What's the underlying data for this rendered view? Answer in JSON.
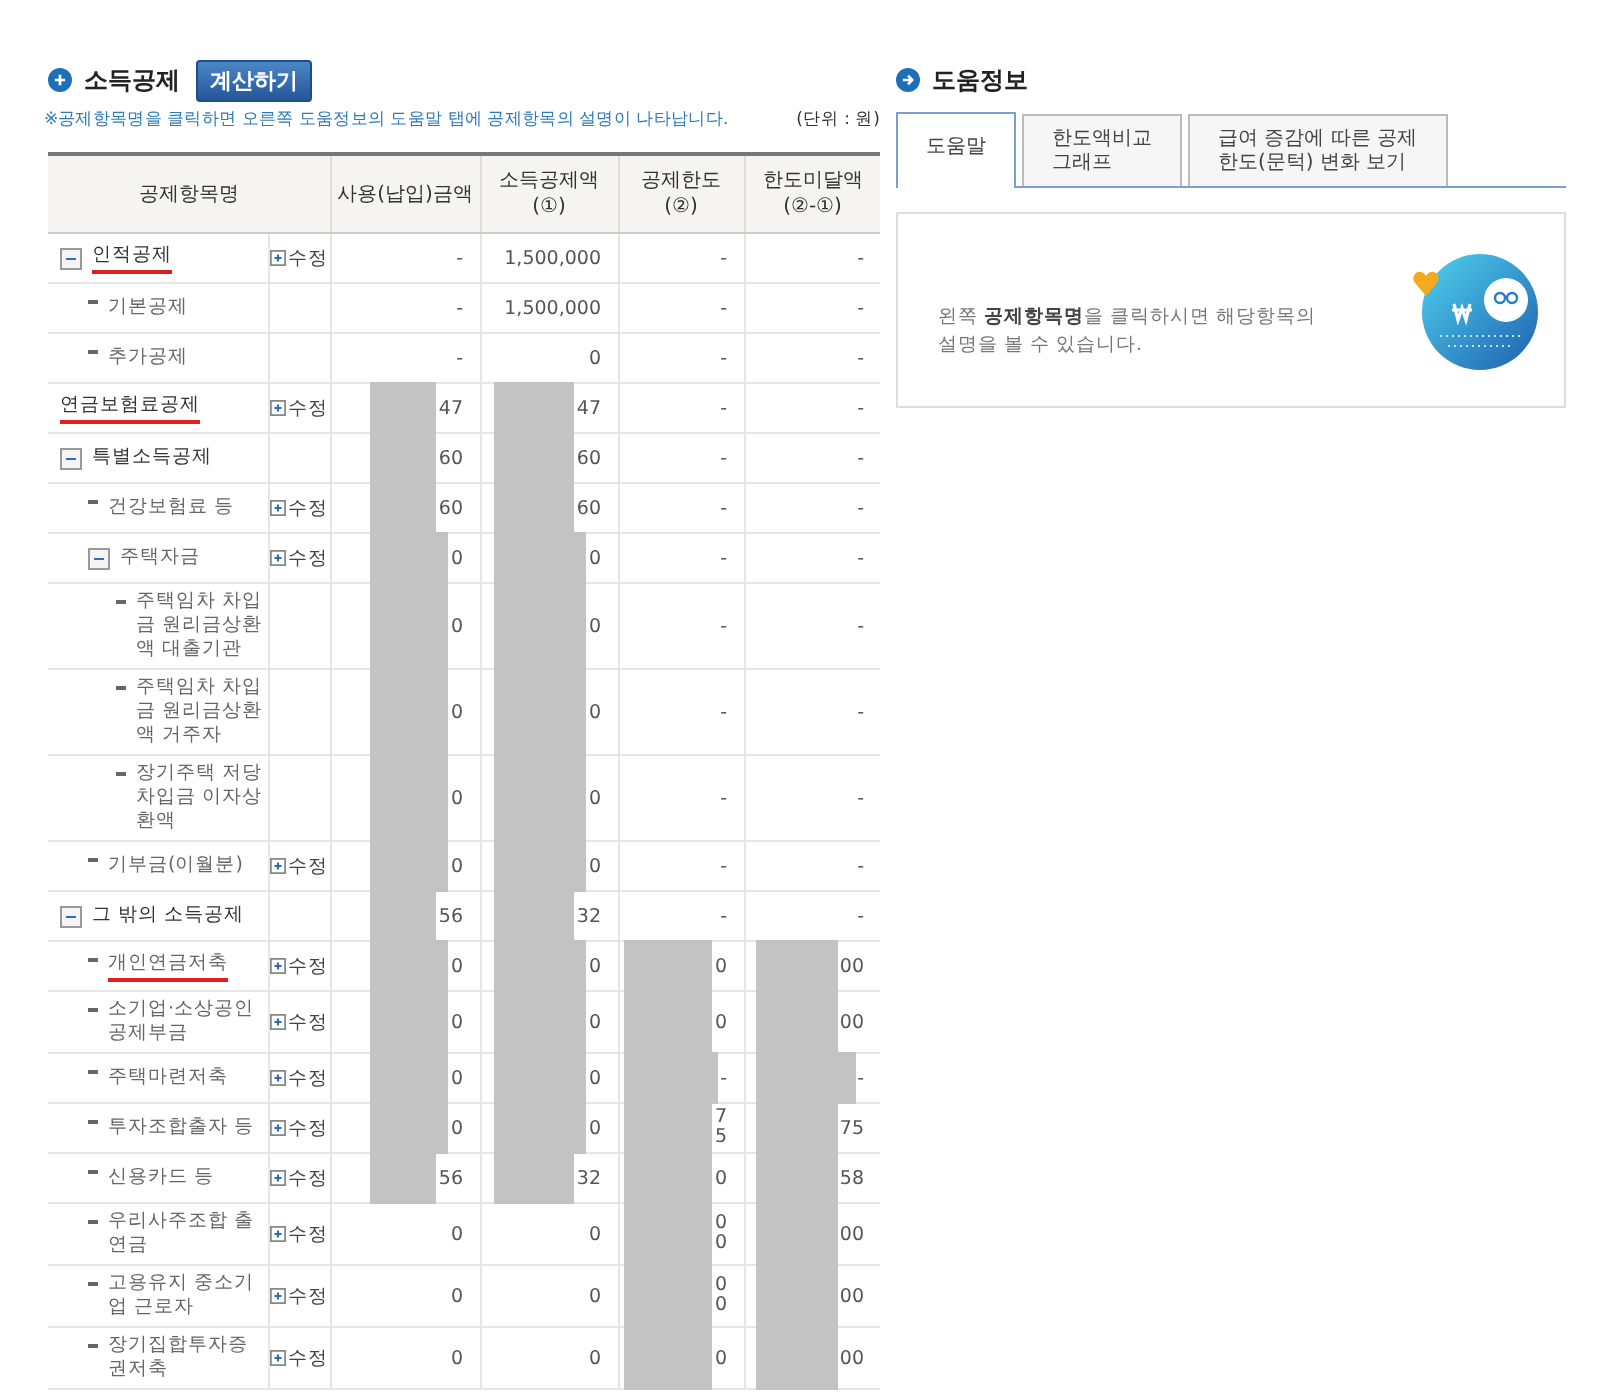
{
  "deduction": {
    "title": "소득공제",
    "calc_button": "계산하기",
    "note": "※공제항목명을 클릭하면 오른쪽 도움정보의 도움말 탭에 공제항목의 설명이 나타납니다.",
    "unit": "(단위 : 원)",
    "columns": [
      "공제항목명",
      "사용(납입)금액",
      "소득공제액(①)",
      "공제한도(②)",
      "한도미달액(②-①)"
    ],
    "rows": [
      {
        "toggle": true,
        "expanded": true,
        "underlined": true,
        "cells": [
          {
            "text": "인적공제",
            "edit": "수정"
          },
          {
            "text": "-",
            "redacted": false
          },
          {
            "text": "1,500,000",
            "redacted": false
          },
          {
            "text": "-",
            "redacted": false
          },
          {
            "text": "-",
            "redacted": false
          }
        ],
        "children": [
          {
            "toggle": false,
            "underlined": false,
            "cells": [
              {
                "text": "기본공제"
              },
              {
                "text": "-",
                "redacted": false
              },
              {
                "text": "1,500,000",
                "redacted": false
              },
              {
                "text": "-",
                "redacted": false
              },
              {
                "text": "-",
                "redacted": false
              }
            ]
          },
          {
            "toggle": false,
            "underlined": false,
            "cells": [
              {
                "text": "추가공제"
              },
              {
                "text": "-",
                "redacted": false
              },
              {
                "text": "0",
                "redacted": false
              },
              {
                "text": "-",
                "redacted": false
              },
              {
                "text": "-",
                "redacted": false
              }
            ]
          }
        ]
      },
      {
        "toggle": false,
        "underlined": true,
        "cells": [
          {
            "text": "연금보험료공제",
            "edit": "수정"
          },
          {
            "text": "47",
            "redacted": true
          },
          {
            "text": "47",
            "redacted": true
          },
          {
            "text": "-",
            "redacted": false
          },
          {
            "text": "-",
            "redacted": false
          }
        ]
      },
      {
        "toggle": true,
        "expanded": true,
        "underlined": false,
        "cells": [
          {
            "text": "특별소득공제"
          },
          {
            "text": "60",
            "redacted": true
          },
          {
            "text": "60",
            "redacted": true
          },
          {
            "text": "-",
            "redacted": false
          },
          {
            "text": "-",
            "redacted": false
          }
        ],
        "children": [
          {
            "toggle": false,
            "underlined": false,
            "cells": [
              {
                "text": "건강보험료 등",
                "edit": "수정"
              },
              {
                "text": "60",
                "redacted": true
              },
              {
                "text": "60",
                "redacted": true
              },
              {
                "text": "-",
                "redacted": false
              },
              {
                "text": "-",
                "redacted": false
              }
            ]
          },
          {
            "toggle": true,
            "expanded": true,
            "underlined": false,
            "cells": [
              {
                "text": "주택자금",
                "edit": "수정"
              },
              {
                "text": "0",
                "redacted": true
              },
              {
                "text": "0",
                "redacted": true
              },
              {
                "text": "-",
                "redacted": false
              },
              {
                "text": "-",
                "redacted": false
              }
            ],
            "children": [
              {
                "toggle": false,
                "underlined": false,
                "cells": [
                  {
                    "text": "주택임차 차입금 원리금상환액 대출기관"
                  },
                  {
                    "text": "0",
                    "redacted": true
                  },
                  {
                    "text": "0",
                    "redacted": true
                  },
                  {
                    "text": "-",
                    "redacted": false
                  },
                  {
                    "text": "-",
                    "redacted": false
                  }
                ]
              },
              {
                "toggle": false,
                "underlined": false,
                "cells": [
                  {
                    "text": "주택임차 차입금 원리금상환액 거주자"
                  },
                  {
                    "text": "0",
                    "redacted": true
                  },
                  {
                    "text": "0",
                    "redacted": true
                  },
                  {
                    "text": "-",
                    "redacted": false
                  },
                  {
                    "text": "-",
                    "redacted": false
                  }
                ]
              },
              {
                "toggle": false,
                "underlined": false,
                "cells": [
                  {
                    "text": "장기주택 저당차입금 이자상환액"
                  },
                  {
                    "text": "0",
                    "redacted": true
                  },
                  {
                    "text": "0",
                    "redacted": true
                  },
                  {
                    "text": "-",
                    "redacted": false
                  },
                  {
                    "text": "-",
                    "redacted": false
                  }
                ]
              }
            ]
          },
          {
            "toggle": false,
            "underlined": false,
            "cells": [
              {
                "text": "기부금(이월분)",
                "edit": "수정"
              },
              {
                "text": "0",
                "redacted": true
              },
              {
                "text": "0",
                "redacted": true
              },
              {
                "text": "-",
                "redacted": false
              },
              {
                "text": "-",
                "redacted": false
              }
            ]
          }
        ]
      },
      {
        "toggle": true,
        "expanded": true,
        "underlined": false,
        "cells": [
          {
            "text": "그 밖의 소득공제"
          },
          {
            "text": "56",
            "redacted": true
          },
          {
            "text": "32",
            "redacted": true
          },
          {
            "text": "-",
            "redacted": false
          },
          {
            "text": "-",
            "redacted": false
          }
        ],
        "children": [
          {
            "toggle": false,
            "underlined": true,
            "cells": [
              {
                "text": "개인연금저축",
                "edit": "수정"
              },
              {
                "text": "0",
                "redacted": true
              },
              {
                "text": "0",
                "redacted": true
              },
              {
                "text": "0",
                "redacted": true
              },
              {
                "text": "00",
                "redacted": true
              }
            ]
          },
          {
            "toggle": false,
            "underlined": false,
            "cells": [
              {
                "text": "소기업·소상공인 공제부금",
                "edit": "수정"
              },
              {
                "text": "0",
                "redacted": true
              },
              {
                "text": "0",
                "redacted": true
              },
              {
                "text": "0",
                "redacted": true
              },
              {
                "text": "00",
                "redacted": true
              }
            ]
          },
          {
            "toggle": false,
            "underlined": false,
            "cells": [
              {
                "text": "주택마련저축",
                "edit": "수정"
              },
              {
                "text": "0",
                "redacted": true
              },
              {
                "text": "0",
                "redacted": true
              },
              {
                "text": "-",
                "redacted": true
              },
              {
                "text": "-",
                "redacted": true
              }
            ]
          },
          {
            "toggle": false,
            "underlined": false,
            "cells": [
              {
                "text": "투자조합출자 등",
                "edit": "수정"
              },
              {
                "text": "0",
                "redacted": true
              },
              {
                "text": "0",
                "redacted": true
              },
              {
                "text": "7\n5",
                "redacted": true
              },
              {
                "text": "75",
                "redacted": true
              }
            ]
          },
          {
            "toggle": false,
            "underlined": false,
            "cells": [
              {
                "text": "신용카드 등",
                "edit": "수정"
              },
              {
                "text": "56",
                "redacted": true
              },
              {
                "text": "32",
                "redacted": true
              },
              {
                "text": "0",
                "redacted": true
              },
              {
                "text": "58",
                "redacted": true
              }
            ]
          },
          {
            "toggle": false,
            "underlined": false,
            "cells": [
              {
                "text": "우리사주조합 출연금",
                "edit": "수정"
              },
              {
                "text": "0",
                "redacted": false
              },
              {
                "text": "0",
                "redacted": false
              },
              {
                "text": "0\n0",
                "redacted": true
              },
              {
                "text": "00",
                "redacted": true
              }
            ]
          },
          {
            "toggle": false,
            "underlined": false,
            "cells": [
              {
                "text": "고용유지 중소기업 근로자",
                "edit": "수정"
              },
              {
                "text": "0",
                "redacted": false
              },
              {
                "text": "0",
                "redacted": false
              },
              {
                "text": "0\n0",
                "redacted": true
              },
              {
                "text": "00",
                "redacted": true
              }
            ]
          },
          {
            "toggle": false,
            "underlined": false,
            "cells": [
              {
                "text": "장기집합투자증권저축",
                "edit": "수정"
              },
              {
                "text": "0",
                "redacted": false
              },
              {
                "text": "0",
                "redacted": false
              },
              {
                "text": "0",
                "redacted": true
              },
              {
                "text": "00",
                "redacted": true
              }
            ]
          }
        ]
      }
    ]
  },
  "help": {
    "title": "도움정보",
    "tabs": [
      {
        "label": "도움말",
        "selected": true
      },
      {
        "label": "한도액비교\n그래프",
        "selected": false
      },
      {
        "label": "급여 증감에 따른 공제\n한도(문턱) 변화 보기",
        "selected": false
      }
    ],
    "message": "왼쪽 **공제항목명**을 클릭하시면 해당항목의 설명을 볼 수 있습니다."
  }
}
